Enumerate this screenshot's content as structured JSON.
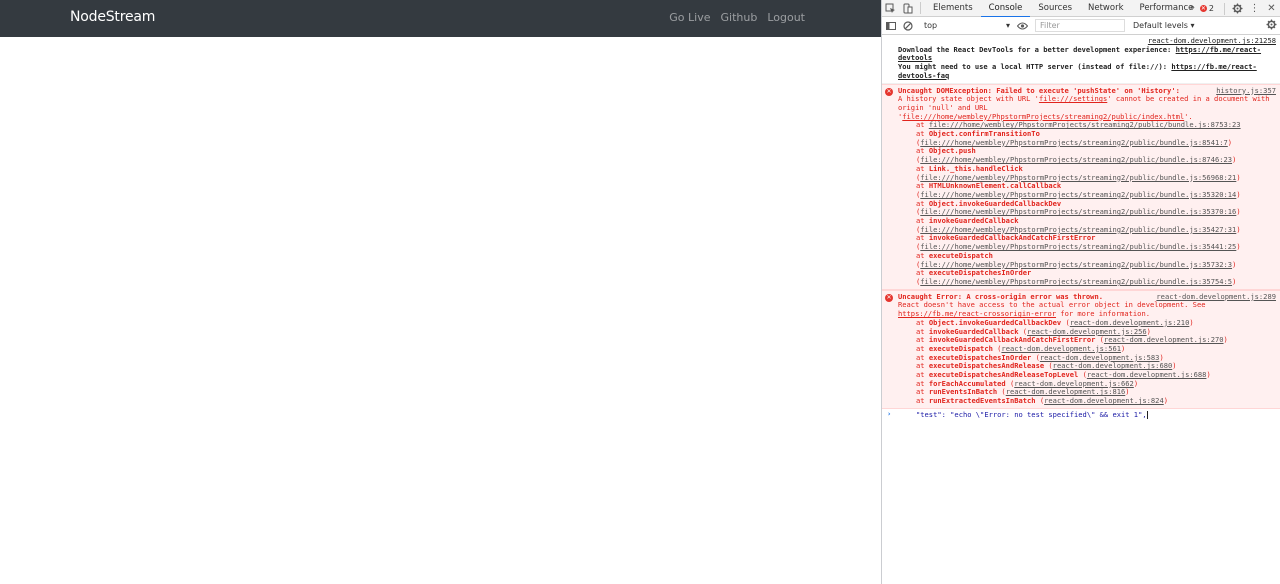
{
  "app": {
    "brand": "NodeStream",
    "nav": [
      "Go Live",
      "Github",
      "Logout"
    ]
  },
  "devtools": {
    "tabs": [
      "Elements",
      "Console",
      "Sources",
      "Network",
      "Performance"
    ],
    "active_tab": "Console",
    "more_tabs": "»",
    "error_count": "2",
    "kebab": "⋮",
    "context": "top",
    "filter_placeholder": "Filter",
    "levels": "Default levels ▾"
  },
  "console": {
    "info": {
      "source": "react-dom.development.js:21258",
      "line1": "Download the React DevTools for a better development experience: ",
      "link1": "https://fb.me/react-devtools",
      "line2": "You might need to use a local HTTP server (instead of file://): ",
      "link2": "https://fb.me/react-devtools-faq"
    },
    "error1": {
      "source": "history.js:357",
      "head": "Uncaught DOMException: Failed to execute 'pushState' on 'History':",
      "body_pre": "A history state object with URL '",
      "url1": "file:///settings",
      "body_mid": "' cannot be created in a document with origin 'null' and URL '",
      "url2": "file:///home/wembley/PhpstormProjects/streaming2/public/index.html",
      "body_post": "'.",
      "stack": [
        {
          "fn": "",
          "loc": "file:///home/wembley/PhpstormProjects/streaming2/public/bundle.js:8753:23"
        },
        {
          "fn": "Object.confirmTransitionTo",
          "loc": "file:///home/wembley/PhpstormProjects/streaming2/public/bundle.js:8541:7"
        },
        {
          "fn": "Object.push",
          "loc": "file:///home/wembley/PhpstormProjects/streaming2/public/bundle.js:8746:23"
        },
        {
          "fn": "Link._this.handleClick",
          "loc": "file:///home/wembley/PhpstormProjects/streaming2/public/bundle.js:56968:21"
        },
        {
          "fn": "HTMLUnknownElement.callCallback",
          "loc": "file:///home/wembley/PhpstormProjects/streaming2/public/bundle.js:35320:14"
        },
        {
          "fn": "Object.invokeGuardedCallbackDev",
          "loc": "file:///home/wembley/PhpstormProjects/streaming2/public/bundle.js:35370:16"
        },
        {
          "fn": "invokeGuardedCallback",
          "loc": "file:///home/wembley/PhpstormProjects/streaming2/public/bundle.js:35427:31"
        },
        {
          "fn": "invokeGuardedCallbackAndCatchFirstError",
          "loc": "file:///home/wembley/PhpstormProjects/streaming2/public/bundle.js:35441:25"
        },
        {
          "fn": "executeDispatch",
          "loc": "file:///home/wembley/PhpstormProjects/streaming2/public/bundle.js:35732:3"
        },
        {
          "fn": "executeDispatchesInOrder",
          "loc": "file:///home/wembley/PhpstormProjects/streaming2/public/bundle.js:35754:5"
        }
      ]
    },
    "error2": {
      "source": "react-dom.development.js:289",
      "head": "Uncaught Error: A cross-origin error was thrown.",
      "body": "React doesn't have access to the actual error object in development. See ",
      "link": "https://fb.me/react-crossorigin-error",
      "body_post": " for more information.",
      "stack": [
        {
          "fn": "Object.invokeGuardedCallbackDev",
          "loc": "react-dom.development.js:210"
        },
        {
          "fn": "invokeGuardedCallback",
          "loc": "react-dom.development.js:256"
        },
        {
          "fn": "invokeGuardedCallbackAndCatchFirstError",
          "loc": "react-dom.development.js:270"
        },
        {
          "fn": "executeDispatch",
          "loc": "react-dom.development.js:561"
        },
        {
          "fn": "executeDispatchesInOrder",
          "loc": "react-dom.development.js:583"
        },
        {
          "fn": "executeDispatchesAndRelease",
          "loc": "react-dom.development.js:680"
        },
        {
          "fn": "executeDispatchesAndReleaseTopLevel",
          "loc": "react-dom.development.js:688"
        },
        {
          "fn": "forEachAccumulated",
          "loc": "react-dom.development.js:662"
        },
        {
          "fn": "runEventsInBatch",
          "loc": "react-dom.development.js:816"
        },
        {
          "fn": "runExtractedEventsInBatch",
          "loc": "react-dom.development.js:824"
        }
      ]
    },
    "prompt_caret": "›",
    "prompt_input": "\"test\": \"echo \\\"Error: no test specified\\\" && exit 1\","
  }
}
